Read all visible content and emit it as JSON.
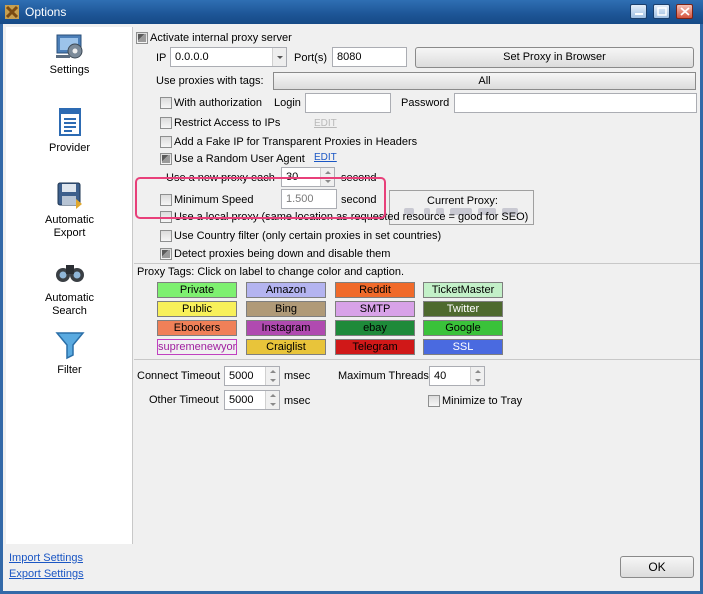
{
  "window": {
    "title": "Options"
  },
  "sidebar": {
    "items": [
      {
        "label": "Settings",
        "icon": "settings-icon"
      },
      {
        "label": "Provider",
        "icon": "provider-icon"
      },
      {
        "label": "Automatic Export",
        "icon": "export-disk-icon"
      },
      {
        "label": "Automatic Search",
        "icon": "binoculars-icon"
      },
      {
        "label": "Filter",
        "icon": "funnel-icon"
      }
    ],
    "import_link": "Import Settings",
    "export_link": "Export Settings"
  },
  "proxy": {
    "activate_label": "Activate internal proxy server",
    "activate_checked": true,
    "ip_label": "IP",
    "ip_value": "0.0.0.0",
    "port_label": "Port(s)",
    "port_value": "8080",
    "set_proxy_button": "Set Proxy in Browser",
    "tags_label": "Use proxies with tags:",
    "tags_value": "All",
    "auth_label": "With authorization",
    "auth_checked": false,
    "login_label": "Login",
    "login_value": "",
    "password_label": "Password",
    "password_value": "",
    "restrict_label": "Restrict Access to IPs",
    "restrict_checked": false,
    "restrict_edit": "EDIT",
    "fakeip_label": "Add a Fake IP for Transparent Proxies in Headers",
    "fakeip_checked": false,
    "random_ua_label": "Use a Random User Agent",
    "random_ua_checked": true,
    "random_ua_edit": "EDIT",
    "new_proxy_label": "Use a new proxy each",
    "new_proxy_value": "30",
    "new_proxy_unit": "second",
    "current_proxy_label": "Current Proxy:",
    "min_speed_label": "Minimum Speed",
    "min_speed_checked": false,
    "min_speed_value": "1.500",
    "min_speed_unit": "second",
    "local_proxy_label": "Use a local proxy (same location as requested resource = good for SEO)",
    "local_proxy_checked": false,
    "country_filter_label": "Use Country filter (only certain proxies in set countries)",
    "country_filter_checked": false,
    "detect_down_label": "Detect proxies being down and disable them",
    "detect_down_checked": true
  },
  "tags": {
    "header": "Proxy Tags: Click on label to change color and caption.",
    "items": [
      {
        "label": "Private",
        "color": "#7ef070",
        "text": "#000000"
      },
      {
        "label": "Amazon",
        "color": "#b4b4f0",
        "text": "#000000"
      },
      {
        "label": "Reddit",
        "color": "#f06a2a",
        "text": "#000000"
      },
      {
        "label": "TicketMaster",
        "color": "#c3f0c8",
        "text": "#000000"
      },
      {
        "label": "Public",
        "color": "#f8f05a",
        "text": "#000000"
      },
      {
        "label": "Bing",
        "color": "#b09a78",
        "text": "#000000"
      },
      {
        "label": "SMTP",
        "color": "#d8a2e8",
        "text": "#000000"
      },
      {
        "label": "Twitter",
        "color": "#4e6a2e",
        "text": "#ffffff"
      },
      {
        "label": "Ebookers",
        "color": "#f08058",
        "text": "#000000"
      },
      {
        "label": "Instagram",
        "color": "#b04ab0",
        "text": "#000000"
      },
      {
        "label": "ebay",
        "color": "#1e8a3a",
        "text": "#000000"
      },
      {
        "label": "Google",
        "color": "#3ac23a",
        "text": "#000000"
      },
      {
        "label": "supremenewyork",
        "color": "#f0f0f0",
        "text": "#a020a0",
        "border": "#c040c0"
      },
      {
        "label": "Craiglist",
        "color": "#e8c43a",
        "text": "#000000"
      },
      {
        "label": "Telegram",
        "color": "#d01818",
        "text": "#000000"
      },
      {
        "label": "SSL",
        "color": "#4a6ae0",
        "text": "#ffffff"
      }
    ]
  },
  "timeouts": {
    "connect_label": "Connect Timeout",
    "connect_value": "5000",
    "connect_unit": "msec",
    "other_label": "Other Timeout",
    "other_value": "5000",
    "other_unit": "msec",
    "threads_label": "Maximum Threads",
    "threads_value": "40",
    "minimize_label": "Minimize to Tray",
    "minimize_checked": false
  },
  "footer": {
    "ok_button": "OK"
  }
}
